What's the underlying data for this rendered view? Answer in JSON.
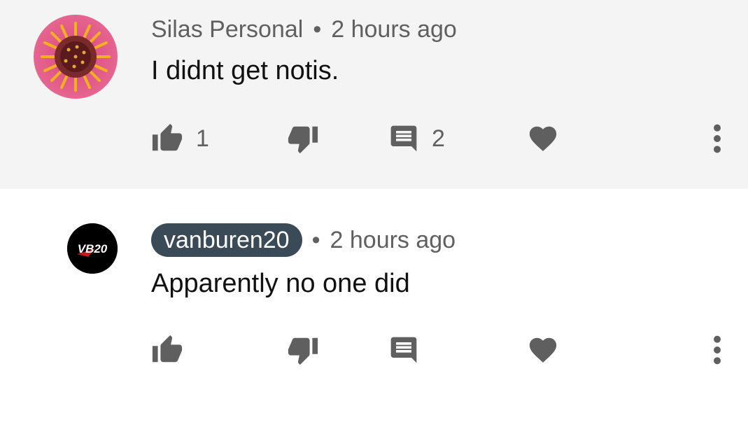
{
  "comments": [
    {
      "author": "Silas Personal",
      "separator": "•",
      "time": "2 hours ago",
      "text": "I didnt get notis.",
      "like_count": "1",
      "reply_count": "2",
      "avatar_icon": "flower-avatar"
    },
    {
      "author": "vanburen20",
      "separator": "•",
      "time": "2 hours ago",
      "text": "Apparently no one did",
      "avatar_icon": "vb20-logo-avatar",
      "avatar_logo_text": "VB20",
      "author_highlight_color": "#3b4a57"
    }
  ],
  "icons": {
    "like": "thumbs-up-icon",
    "dislike": "thumbs-down-icon",
    "reply": "reply-icon",
    "heart": "heart-icon",
    "more": "more-vert-icon"
  },
  "colors": {
    "highlight_background": "#f4f4f4",
    "icon": "#5f5f5f",
    "meta_text": "#606060"
  }
}
